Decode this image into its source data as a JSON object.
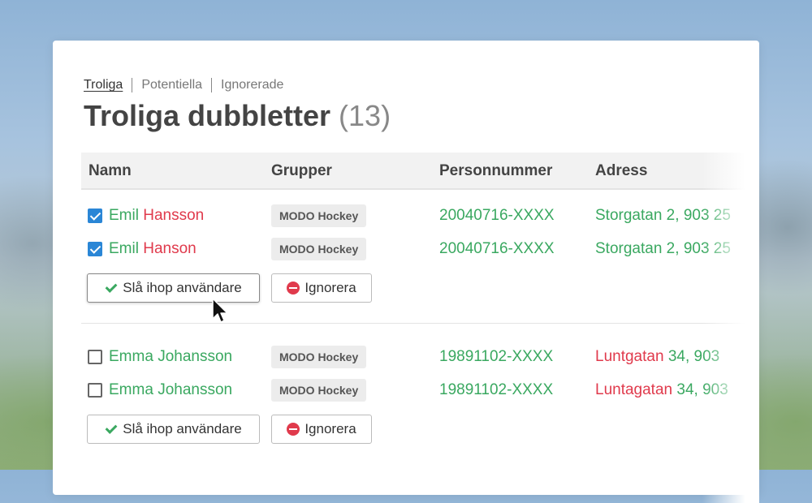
{
  "tabs": [
    "Troliga",
    "Potentiella",
    "Ignorerade"
  ],
  "title": "Troliga dubbletter",
  "count": "(13)",
  "columns": {
    "name": "Namn",
    "groups": "Grupper",
    "pnr": "Personnummer",
    "address": "Adress"
  },
  "groups": [
    {
      "rows": [
        {
          "checked": true,
          "first": "Emil",
          "last": "Hansson",
          "group": "MODO Hockey",
          "pnr": "20040716-XXXX",
          "addr_street": "Storgatan 2,",
          "addr_rest": "903 25"
        },
        {
          "checked": true,
          "first": "Emil",
          "last": "Hanson",
          "group": "MODO Hockey",
          "pnr": "20040716-XXXX",
          "addr_street": "Storgatan 2,",
          "addr_rest": "903 25"
        }
      ],
      "merge_label": "Slå ihop användare",
      "ignore_label": "Ignorera"
    },
    {
      "rows": [
        {
          "checked": false,
          "first": "Emma",
          "last": "Johansson",
          "group": "MODO Hockey",
          "pnr": "19891102-XXXX",
          "addr_street": "Luntgatan",
          "addr_rest": "34, 903"
        },
        {
          "checked": false,
          "first": "Emma",
          "last": "Johansson",
          "group": "MODO Hockey",
          "pnr": "19891102-XXXX",
          "addr_street": "Luntagatan",
          "addr_rest": "34, 903"
        }
      ],
      "merge_label": "Slå ihop användare",
      "ignore_label": "Ignorera"
    }
  ],
  "colors": {
    "match": "#3aa860",
    "mismatch": "#e03a4c",
    "checkbox": "#2a86d6"
  }
}
